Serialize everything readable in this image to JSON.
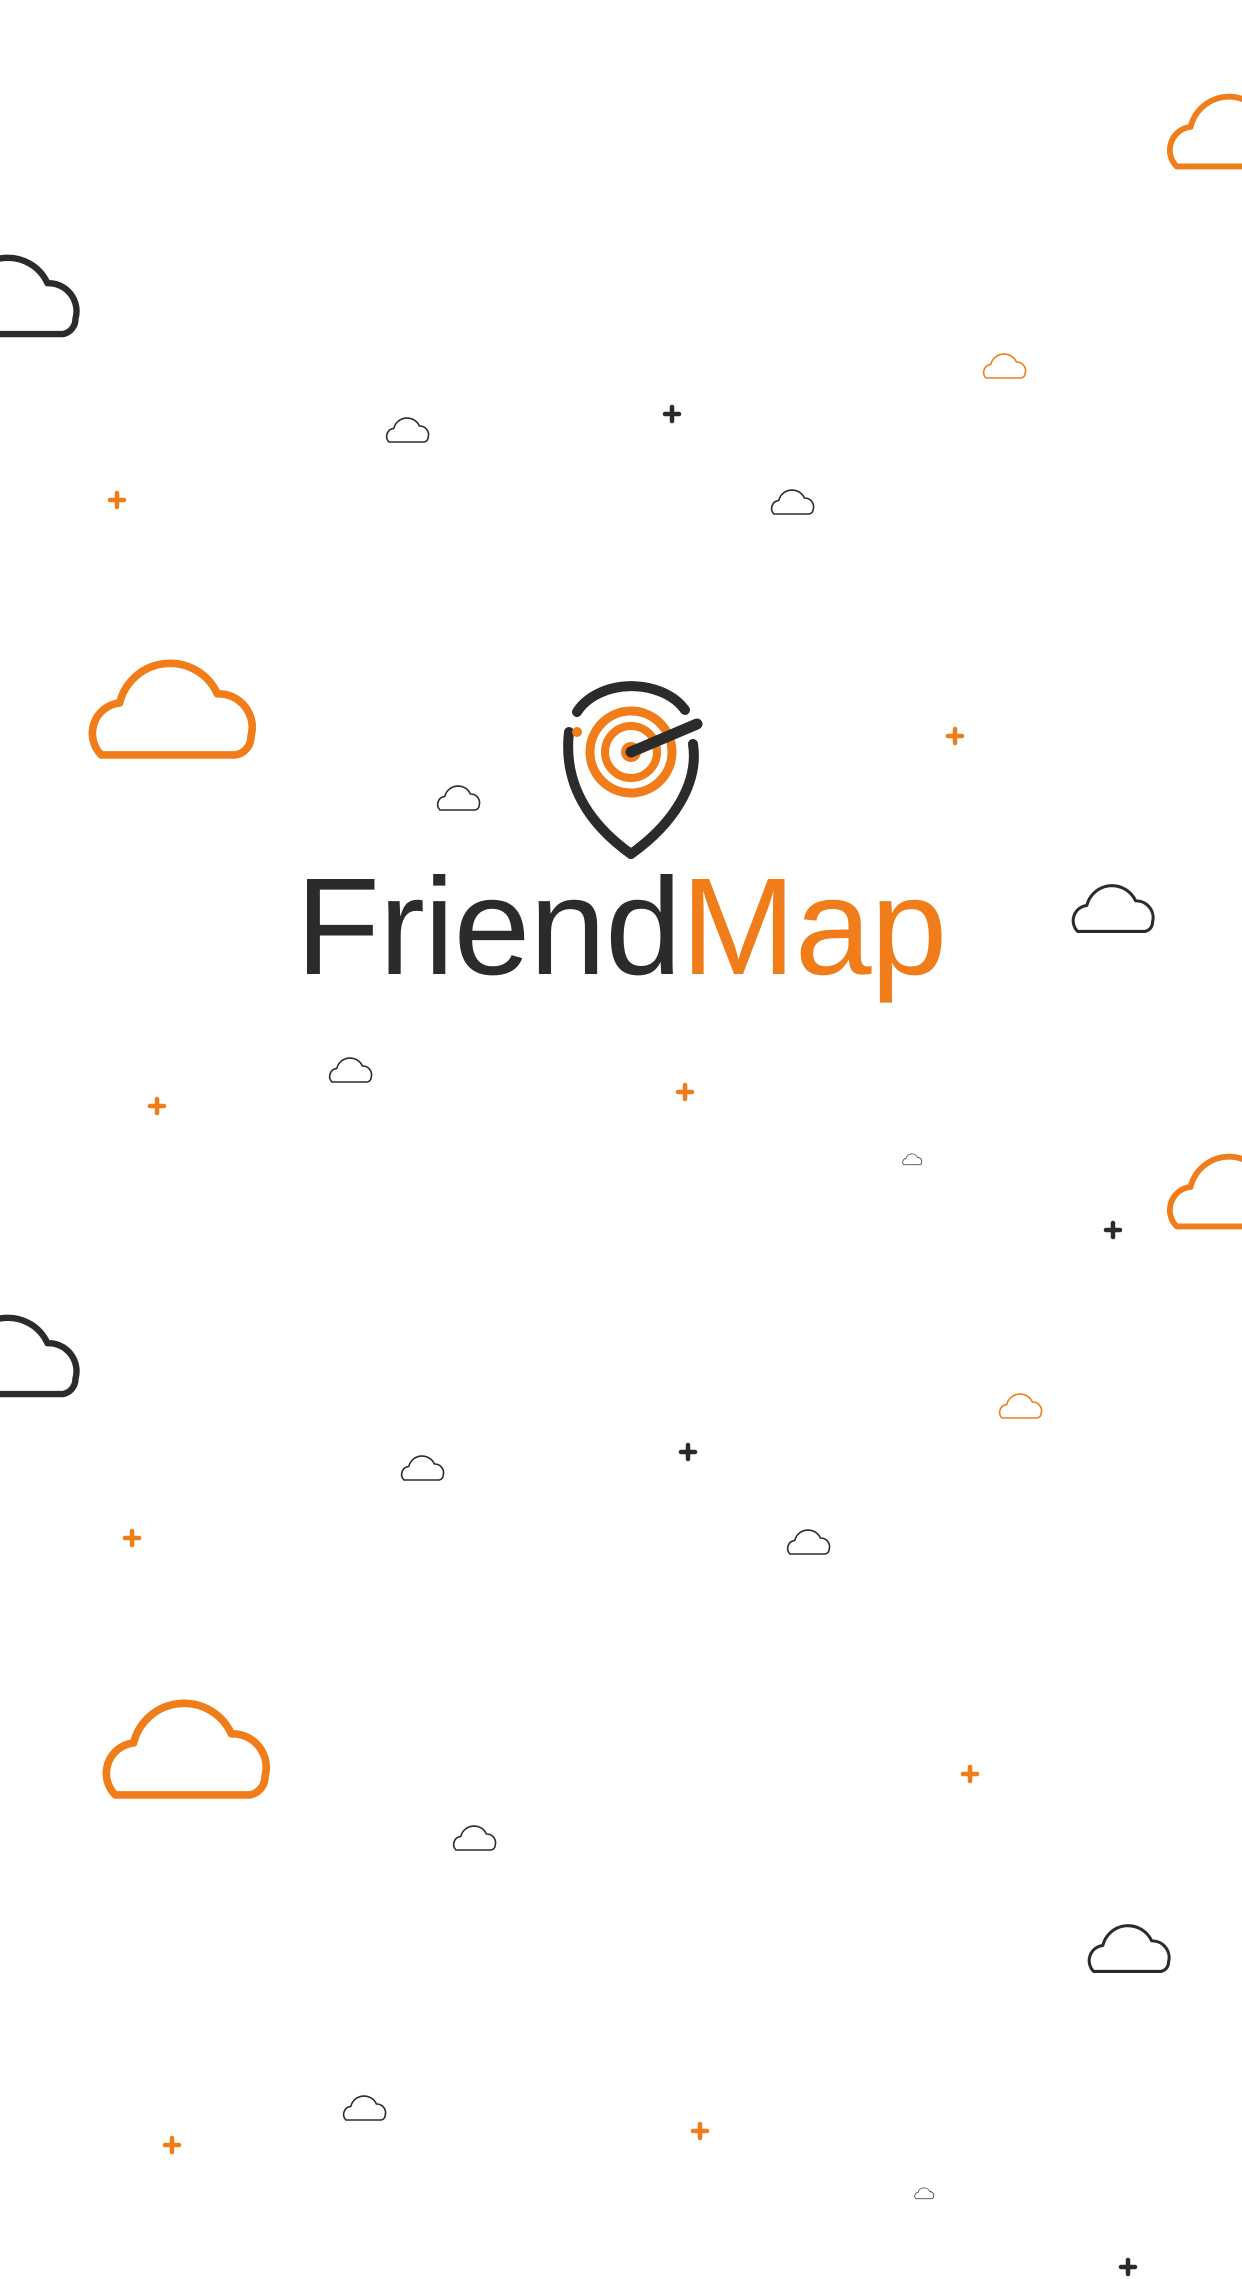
{
  "app": {
    "name_part_1": "Friend",
    "name_part_2": "Map"
  },
  "colors": {
    "background": "#ffffff",
    "dark": "#2b2b2b",
    "accent": "#f07d1a"
  },
  "icons": {
    "logo": "location-pin-target-icon",
    "decor_cloud": "cloud-outline-icon",
    "decor_sparkle": "plus-sparkle-icon"
  }
}
